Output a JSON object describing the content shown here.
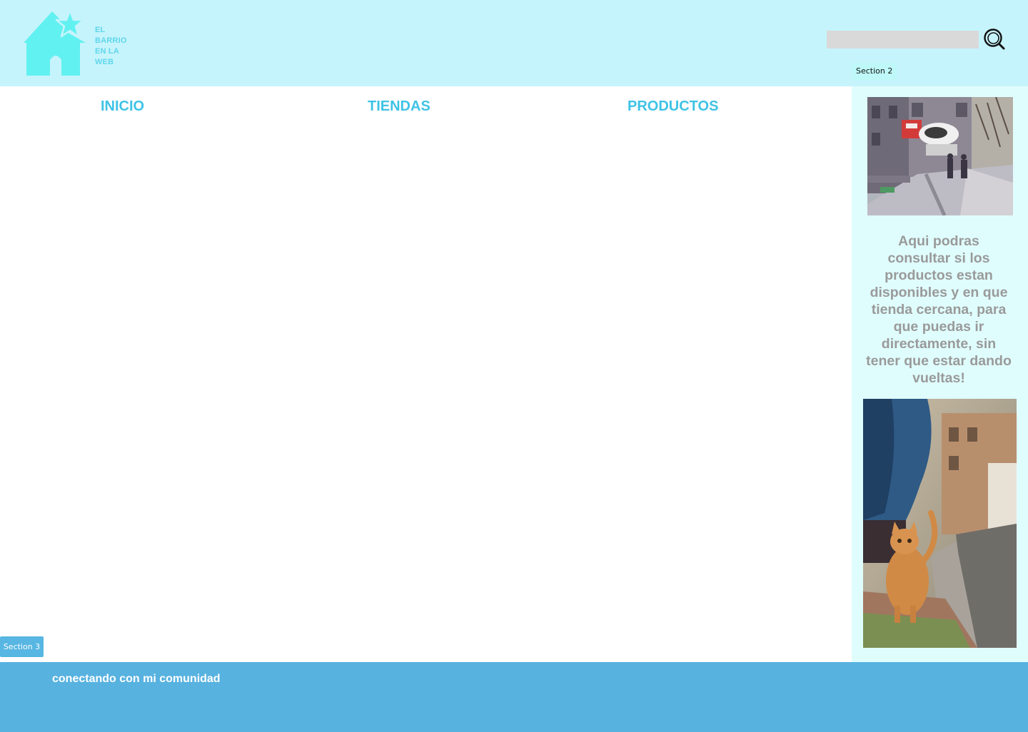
{
  "header": {
    "logo": {
      "icon": "house-star-icon",
      "lines": [
        "EL",
        "BARRIO",
        "EN LA",
        "WEB"
      ]
    },
    "search": {
      "value": "",
      "placeholder": "",
      "icon": "search-icon"
    },
    "section_tag": "Section 2"
  },
  "nav": {
    "items": [
      {
        "label": "INICIO"
      },
      {
        "label": "TIENDAS"
      },
      {
        "label": "PRODUCTOS"
      }
    ]
  },
  "sidebar": {
    "description": "Aqui podras consultar si los productos estan disponibles y en que tienda cercana, para que puedas ir directamente, sin tener que estar dando vueltas!"
  },
  "section3_tag": "Section 3",
  "footer": {
    "tagline": "conectando con mi comunidad"
  },
  "colors": {
    "header_bg": "#c6f4fc",
    "logo": "#5fd6ec",
    "nav_link": "#3fc3e6",
    "sidebar_bg": "#e0fdfd",
    "sidebar_text": "#9a9a9a",
    "footer_bg": "#57b2e0"
  }
}
